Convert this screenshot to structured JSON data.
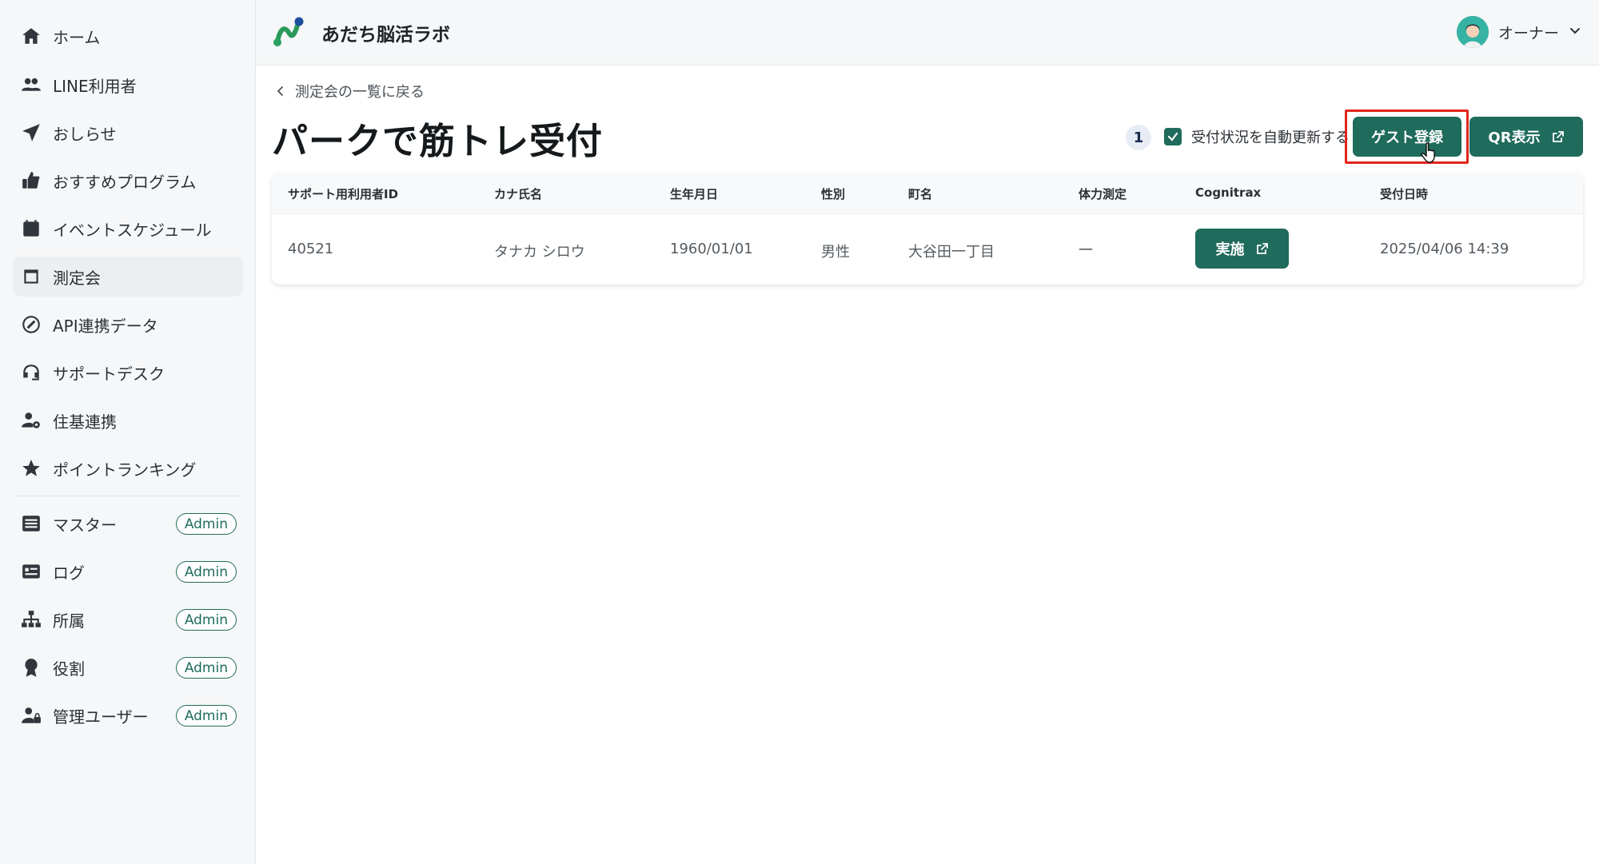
{
  "sidebar": {
    "items": [
      {
        "label": "ホーム",
        "icon": "home-icon"
      },
      {
        "label": "LINE利用者",
        "icon": "users-icon"
      },
      {
        "label": "おしらせ",
        "icon": "send-icon"
      },
      {
        "label": "おすすめプログラム",
        "icon": "thumbs-up-icon"
      },
      {
        "label": "イベントスケジュール",
        "icon": "calendar-icon"
      },
      {
        "label": "測定会",
        "icon": "measure-icon",
        "active": true
      },
      {
        "label": "API連携データ",
        "icon": "api-icon"
      },
      {
        "label": "サポートデスク",
        "icon": "headset-icon"
      },
      {
        "label": "住基連携",
        "icon": "user-gear-icon"
      },
      {
        "label": "ポイントランキング",
        "icon": "star-icon"
      }
    ],
    "admin_items": [
      {
        "label": "マスター",
        "badge": "Admin",
        "icon": "database-icon"
      },
      {
        "label": "ログ",
        "badge": "Admin",
        "icon": "log-icon"
      },
      {
        "label": "所属",
        "badge": "Admin",
        "icon": "org-chart-icon"
      },
      {
        "label": "役割",
        "badge": "Admin",
        "icon": "award-icon"
      },
      {
        "label": "管理ユーザー",
        "badge": "Admin",
        "icon": "admin-user-icon"
      }
    ]
  },
  "header": {
    "app_title": "あだち脳活ラボ",
    "user_name": "オーナー"
  },
  "main": {
    "back_label": "測定会の一覧に戻る",
    "page_title": "パークで筋トレ受付",
    "count": "1",
    "auto_refresh_label": "受付状況を自動更新する",
    "auto_refresh_checked": true,
    "guest_button": "ゲスト登録",
    "qr_button": "QR表示"
  },
  "table": {
    "columns": [
      "サポート用利用者ID",
      "カナ氏名",
      "生年月日",
      "性別",
      "町名",
      "体力測定",
      "Cognitrax",
      "受付日時"
    ],
    "rows": [
      {
        "id": "40521",
        "kana": "タナカ シロウ",
        "birth": "1960/01/01",
        "gender": "男性",
        "town": "大谷田一丁目",
        "fitness": "—",
        "cognitrax": "実施",
        "received": "2025/04/06 14:39"
      }
    ]
  },
  "colors": {
    "accent": "#1f6b5c",
    "highlight": "#e2261c",
    "sidebar_bg": "#f6f7f8"
  }
}
